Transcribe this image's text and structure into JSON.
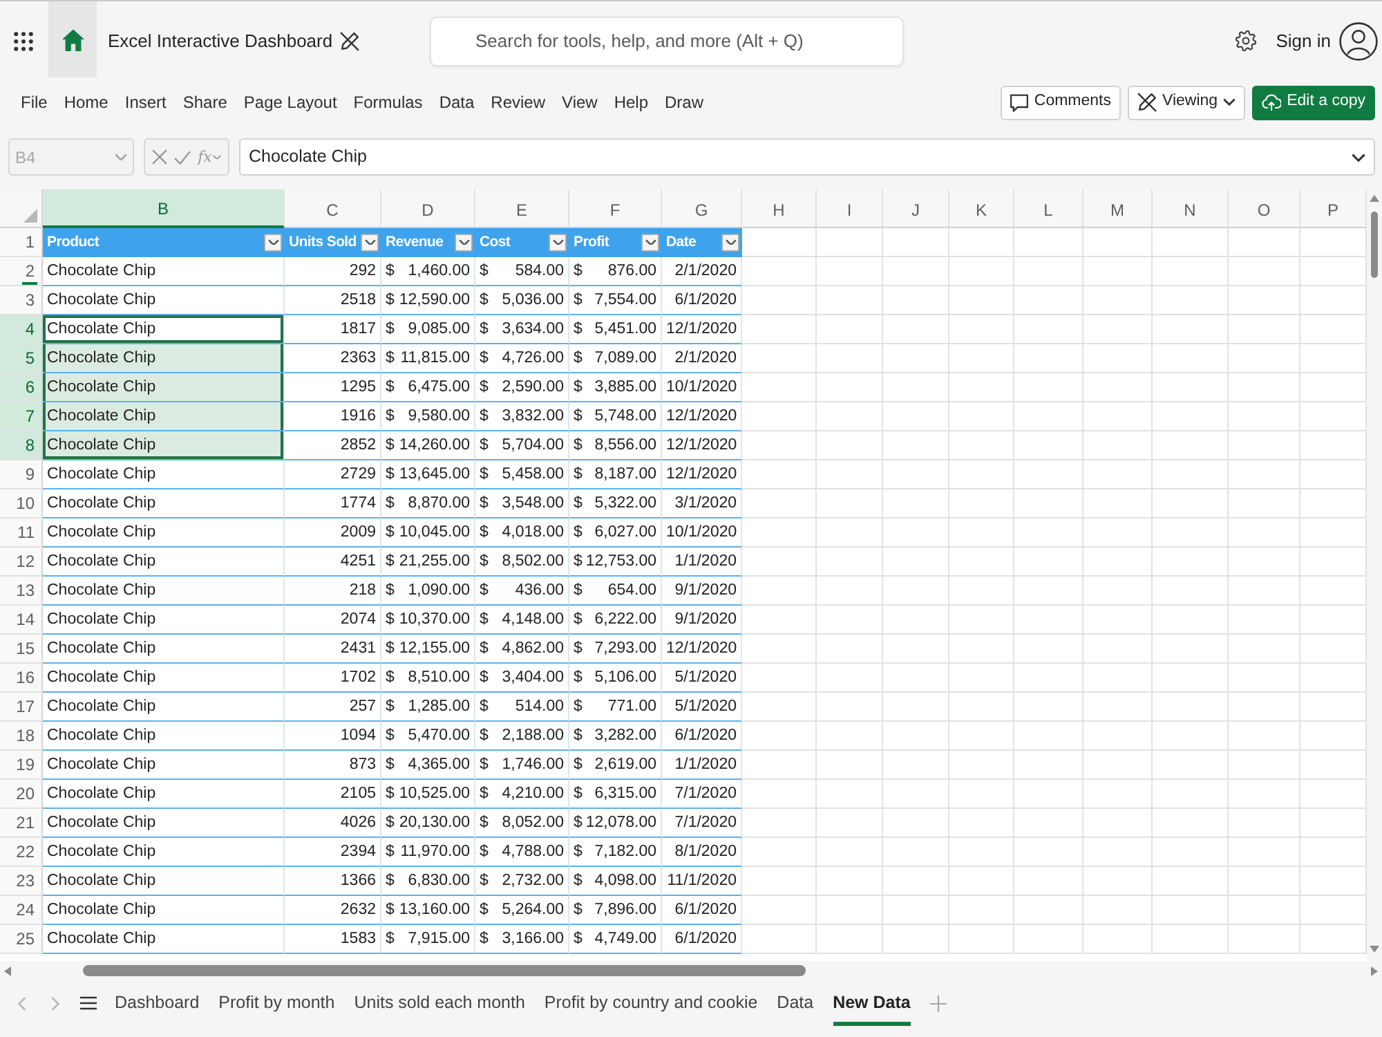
{
  "app_bar": {
    "title": "Excel Interactive Dashboard",
    "search_placeholder": "Search for tools, help, and more (Alt + Q)",
    "sign_in": "Sign in"
  },
  "menu": [
    "File",
    "Home",
    "Insert",
    "Share",
    "Page Layout",
    "Formulas",
    "Data",
    "Review",
    "View",
    "Help",
    "Draw"
  ],
  "actions": [
    {
      "kind": "comments",
      "label": "Comments"
    },
    {
      "kind": "viewing",
      "label": "Viewing"
    },
    {
      "kind": "edit",
      "label": "Edit a copy"
    }
  ],
  "formula_bar": {
    "name_box": "B4",
    "function_label": "fx",
    "value": "Chocolate Chip"
  },
  "sheet": {
    "column_headers": [
      {
        "letter": "B",
        "selected": true
      },
      {
        "letter": "C",
        "selected": false
      },
      {
        "letter": "D",
        "selected": false
      },
      {
        "letter": "E",
        "selected": false
      },
      {
        "letter": "F",
        "selected": false
      },
      {
        "letter": "G",
        "selected": false
      },
      {
        "letter": "H",
        "selected": false
      },
      {
        "letter": "I",
        "selected": false
      },
      {
        "letter": "J",
        "selected": false
      },
      {
        "letter": "K",
        "selected": false
      },
      {
        "letter": "L",
        "selected": false
      },
      {
        "letter": "M",
        "selected": false
      },
      {
        "letter": "N",
        "selected": false
      },
      {
        "letter": "O",
        "selected": false
      },
      {
        "letter": "P",
        "selected": false
      }
    ],
    "fields": [
      {
        "label": "Product",
        "kind": "text"
      },
      {
        "label": "Units Sold",
        "kind": "number"
      },
      {
        "label": "Revenue",
        "kind": "currency"
      },
      {
        "label": "Cost",
        "kind": "currency"
      },
      {
        "label": "Profit",
        "kind": "currency"
      },
      {
        "label": "Date",
        "kind": "date"
      }
    ],
    "header_row_number": "1",
    "rows": [
      {
        "number": "2",
        "selected": false,
        "active": false,
        "marked": true,
        "cells": [
          "Chocolate Chip",
          "292",
          {
            "symbol": "$",
            "amount": "1,460.00"
          },
          {
            "symbol": "$",
            "amount": "584.00"
          },
          {
            "symbol": "$",
            "amount": "876.00"
          },
          "2/1/2020"
        ]
      },
      {
        "number": "3",
        "selected": false,
        "active": false,
        "marked": false,
        "cells": [
          "Chocolate Chip",
          "2518",
          {
            "symbol": "$",
            "amount": "12,590.00"
          },
          {
            "symbol": "$",
            "amount": "5,036.00"
          },
          {
            "symbol": "$",
            "amount": "7,554.00"
          },
          "6/1/2020"
        ]
      },
      {
        "number": "4",
        "selected": true,
        "active": true,
        "marked": false,
        "cells": [
          "Chocolate Chip",
          "1817",
          {
            "symbol": "$",
            "amount": "9,085.00"
          },
          {
            "symbol": "$",
            "amount": "3,634.00"
          },
          {
            "symbol": "$",
            "amount": "5,451.00"
          },
          "12/1/2020"
        ]
      },
      {
        "number": "5",
        "selected": true,
        "active": false,
        "marked": false,
        "cells": [
          "Chocolate Chip",
          "2363",
          {
            "symbol": "$",
            "amount": "11,815.00"
          },
          {
            "symbol": "$",
            "amount": "4,726.00"
          },
          {
            "symbol": "$",
            "amount": "7,089.00"
          },
          "2/1/2020"
        ]
      },
      {
        "number": "6",
        "selected": true,
        "active": false,
        "marked": false,
        "cells": [
          "Chocolate Chip",
          "1295",
          {
            "symbol": "$",
            "amount": "6,475.00"
          },
          {
            "symbol": "$",
            "amount": "2,590.00"
          },
          {
            "symbol": "$",
            "amount": "3,885.00"
          },
          "10/1/2020"
        ]
      },
      {
        "number": "7",
        "selected": true,
        "active": false,
        "marked": false,
        "cells": [
          "Chocolate Chip",
          "1916",
          {
            "symbol": "$",
            "amount": "9,580.00"
          },
          {
            "symbol": "$",
            "amount": "3,832.00"
          },
          {
            "symbol": "$",
            "amount": "5,748.00"
          },
          "12/1/2020"
        ]
      },
      {
        "number": "8",
        "selected": true,
        "active": false,
        "marked": false,
        "cells": [
          "Chocolate Chip",
          "2852",
          {
            "symbol": "$",
            "amount": "14,260.00"
          },
          {
            "symbol": "$",
            "amount": "5,704.00"
          },
          {
            "symbol": "$",
            "amount": "8,556.00"
          },
          "12/1/2020"
        ]
      },
      {
        "number": "9",
        "selected": false,
        "active": false,
        "marked": false,
        "cells": [
          "Chocolate Chip",
          "2729",
          {
            "symbol": "$",
            "amount": "13,645.00"
          },
          {
            "symbol": "$",
            "amount": "5,458.00"
          },
          {
            "symbol": "$",
            "amount": "8,187.00"
          },
          "12/1/2020"
        ]
      },
      {
        "number": "10",
        "selected": false,
        "active": false,
        "marked": false,
        "cells": [
          "Chocolate Chip",
          "1774",
          {
            "symbol": "$",
            "amount": "8,870.00"
          },
          {
            "symbol": "$",
            "amount": "3,548.00"
          },
          {
            "symbol": "$",
            "amount": "5,322.00"
          },
          "3/1/2020"
        ]
      },
      {
        "number": "11",
        "selected": false,
        "active": false,
        "marked": false,
        "cells": [
          "Chocolate Chip",
          "2009",
          {
            "symbol": "$",
            "amount": "10,045.00"
          },
          {
            "symbol": "$",
            "amount": "4,018.00"
          },
          {
            "symbol": "$",
            "amount": "6,027.00"
          },
          "10/1/2020"
        ]
      },
      {
        "number": "12",
        "selected": false,
        "active": false,
        "marked": false,
        "cells": [
          "Chocolate Chip",
          "4251",
          {
            "symbol": "$",
            "amount": "21,255.00"
          },
          {
            "symbol": "$",
            "amount": "8,502.00"
          },
          {
            "symbol": "$",
            "amount": "12,753.00"
          },
          "1/1/2020"
        ]
      },
      {
        "number": "13",
        "selected": false,
        "active": false,
        "marked": false,
        "cells": [
          "Chocolate Chip",
          "218",
          {
            "symbol": "$",
            "amount": "1,090.00"
          },
          {
            "symbol": "$",
            "amount": "436.00"
          },
          {
            "symbol": "$",
            "amount": "654.00"
          },
          "9/1/2020"
        ]
      },
      {
        "number": "14",
        "selected": false,
        "active": false,
        "marked": false,
        "cells": [
          "Chocolate Chip",
          "2074",
          {
            "symbol": "$",
            "amount": "10,370.00"
          },
          {
            "symbol": "$",
            "amount": "4,148.00"
          },
          {
            "symbol": "$",
            "amount": "6,222.00"
          },
          "9/1/2020"
        ]
      },
      {
        "number": "15",
        "selected": false,
        "active": false,
        "marked": false,
        "cells": [
          "Chocolate Chip",
          "2431",
          {
            "symbol": "$",
            "amount": "12,155.00"
          },
          {
            "symbol": "$",
            "amount": "4,862.00"
          },
          {
            "symbol": "$",
            "amount": "7,293.00"
          },
          "12/1/2020"
        ]
      },
      {
        "number": "16",
        "selected": false,
        "active": false,
        "marked": false,
        "cells": [
          "Chocolate Chip",
          "1702",
          {
            "symbol": "$",
            "amount": "8,510.00"
          },
          {
            "symbol": "$",
            "amount": "3,404.00"
          },
          {
            "symbol": "$",
            "amount": "5,106.00"
          },
          "5/1/2020"
        ]
      },
      {
        "number": "17",
        "selected": false,
        "active": false,
        "marked": false,
        "cells": [
          "Chocolate Chip",
          "257",
          {
            "symbol": "$",
            "amount": "1,285.00"
          },
          {
            "symbol": "$",
            "amount": "514.00"
          },
          {
            "symbol": "$",
            "amount": "771.00"
          },
          "5/1/2020"
        ]
      },
      {
        "number": "18",
        "selected": false,
        "active": false,
        "marked": false,
        "cells": [
          "Chocolate Chip",
          "1094",
          {
            "symbol": "$",
            "amount": "5,470.00"
          },
          {
            "symbol": "$",
            "amount": "2,188.00"
          },
          {
            "symbol": "$",
            "amount": "3,282.00"
          },
          "6/1/2020"
        ]
      },
      {
        "number": "19",
        "selected": false,
        "active": false,
        "marked": false,
        "cells": [
          "Chocolate Chip",
          "873",
          {
            "symbol": "$",
            "amount": "4,365.00"
          },
          {
            "symbol": "$",
            "amount": "1,746.00"
          },
          {
            "symbol": "$",
            "amount": "2,619.00"
          },
          "1/1/2020"
        ]
      },
      {
        "number": "20",
        "selected": false,
        "active": false,
        "marked": false,
        "cells": [
          "Chocolate Chip",
          "2105",
          {
            "symbol": "$",
            "amount": "10,525.00"
          },
          {
            "symbol": "$",
            "amount": "4,210.00"
          },
          {
            "symbol": "$",
            "amount": "6,315.00"
          },
          "7/1/2020"
        ]
      },
      {
        "number": "21",
        "selected": false,
        "active": false,
        "marked": false,
        "cells": [
          "Chocolate Chip",
          "4026",
          {
            "symbol": "$",
            "amount": "20,130.00"
          },
          {
            "symbol": "$",
            "amount": "8,052.00"
          },
          {
            "symbol": "$",
            "amount": "12,078.00"
          },
          "7/1/2020"
        ]
      },
      {
        "number": "22",
        "selected": false,
        "active": false,
        "marked": false,
        "cells": [
          "Chocolate Chip",
          "2394",
          {
            "symbol": "$",
            "amount": "11,970.00"
          },
          {
            "symbol": "$",
            "amount": "4,788.00"
          },
          {
            "symbol": "$",
            "amount": "7,182.00"
          },
          "8/1/2020"
        ]
      },
      {
        "number": "23",
        "selected": false,
        "active": false,
        "marked": false,
        "cells": [
          "Chocolate Chip",
          "1366",
          {
            "symbol": "$",
            "amount": "6,830.00"
          },
          {
            "symbol": "$",
            "amount": "2,732.00"
          },
          {
            "symbol": "$",
            "amount": "4,098.00"
          },
          "11/1/2020"
        ]
      },
      {
        "number": "24",
        "selected": false,
        "active": false,
        "marked": false,
        "cells": [
          "Chocolate Chip",
          "2632",
          {
            "symbol": "$",
            "amount": "13,160.00"
          },
          {
            "symbol": "$",
            "amount": "5,264.00"
          },
          {
            "symbol": "$",
            "amount": "7,896.00"
          },
          "6/1/2020"
        ]
      },
      {
        "number": "25",
        "selected": false,
        "active": false,
        "marked": false,
        "cells": [
          "Chocolate Chip",
          "1583",
          {
            "symbol": "$",
            "amount": "7,915.00"
          },
          {
            "symbol": "$",
            "amount": "3,166.00"
          },
          {
            "symbol": "$",
            "amount": "4,749.00"
          },
          "6/1/2020"
        ]
      }
    ]
  },
  "sheet_tabs": [
    {
      "label": "Dashboard",
      "selected": false
    },
    {
      "label": "Profit by month",
      "selected": false
    },
    {
      "label": "Units sold each month",
      "selected": false
    },
    {
      "label": "Profit by country and cookie",
      "selected": false
    },
    {
      "label": "Data",
      "selected": false
    },
    {
      "label": "New Data",
      "selected": true
    }
  ]
}
